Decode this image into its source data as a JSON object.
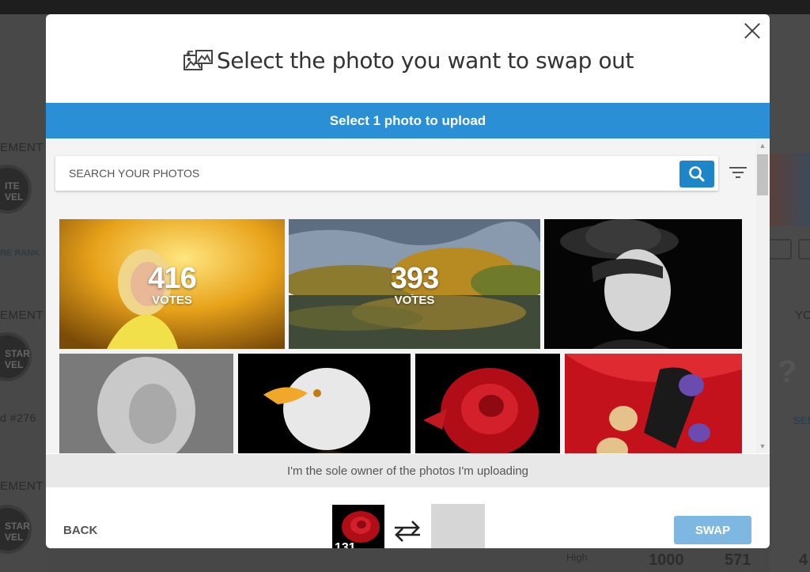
{
  "background": {
    "left_labels": [
      "EMENT",
      "ITE",
      "VEL",
      "RE RANK",
      "EMENT",
      "STAR",
      "VEL",
      "d #276",
      "EMENT",
      "STAR",
      "VEL"
    ],
    "right_labels": [
      "YO",
      "?",
      "SEE"
    ],
    "bottom_numbers": [
      "1000",
      "571",
      "4"
    ],
    "bottom_word": "High"
  },
  "modal": {
    "title": "Select the photo you want to swap out",
    "title_icon": "photo-swap-icon",
    "close_icon": "close-icon",
    "upload_bar": "Select 1 photo to upload",
    "search": {
      "placeholder": "SEARCH YOUR PHOTOS",
      "value": "",
      "button_icon": "search-icon"
    },
    "filter_icon": "filter-icon",
    "photos": [
      {
        "subject": "woman-golden-light",
        "votes": "416",
        "votes_label": "VOTES"
      },
      {
        "subject": "lake-autumn-trees",
        "votes": "393",
        "votes_label": "VOTES"
      },
      {
        "subject": "boy-hat-bw",
        "votes": "",
        "votes_label": ""
      },
      {
        "subject": "woman-bw-portrait",
        "votes": "",
        "votes_label": ""
      },
      {
        "subject": "bald-eagle",
        "votes": "",
        "votes_label": ""
      },
      {
        "subject": "red-rose",
        "votes": "",
        "votes_label": ""
      },
      {
        "subject": "shoe-red-satin",
        "votes": "",
        "votes_label": ""
      }
    ],
    "owner_text": "I'm the sole owner of the photos I'm uploading",
    "footer": {
      "back_label": "BACK",
      "swap_label": "SWAP",
      "selected_count": "131",
      "swap_arrows_icon": "swap-arrows-icon"
    },
    "colors": {
      "accent": "#2a8fd4",
      "swap_button": "#7eb8e2",
      "search_button": "#1f85c9"
    }
  }
}
